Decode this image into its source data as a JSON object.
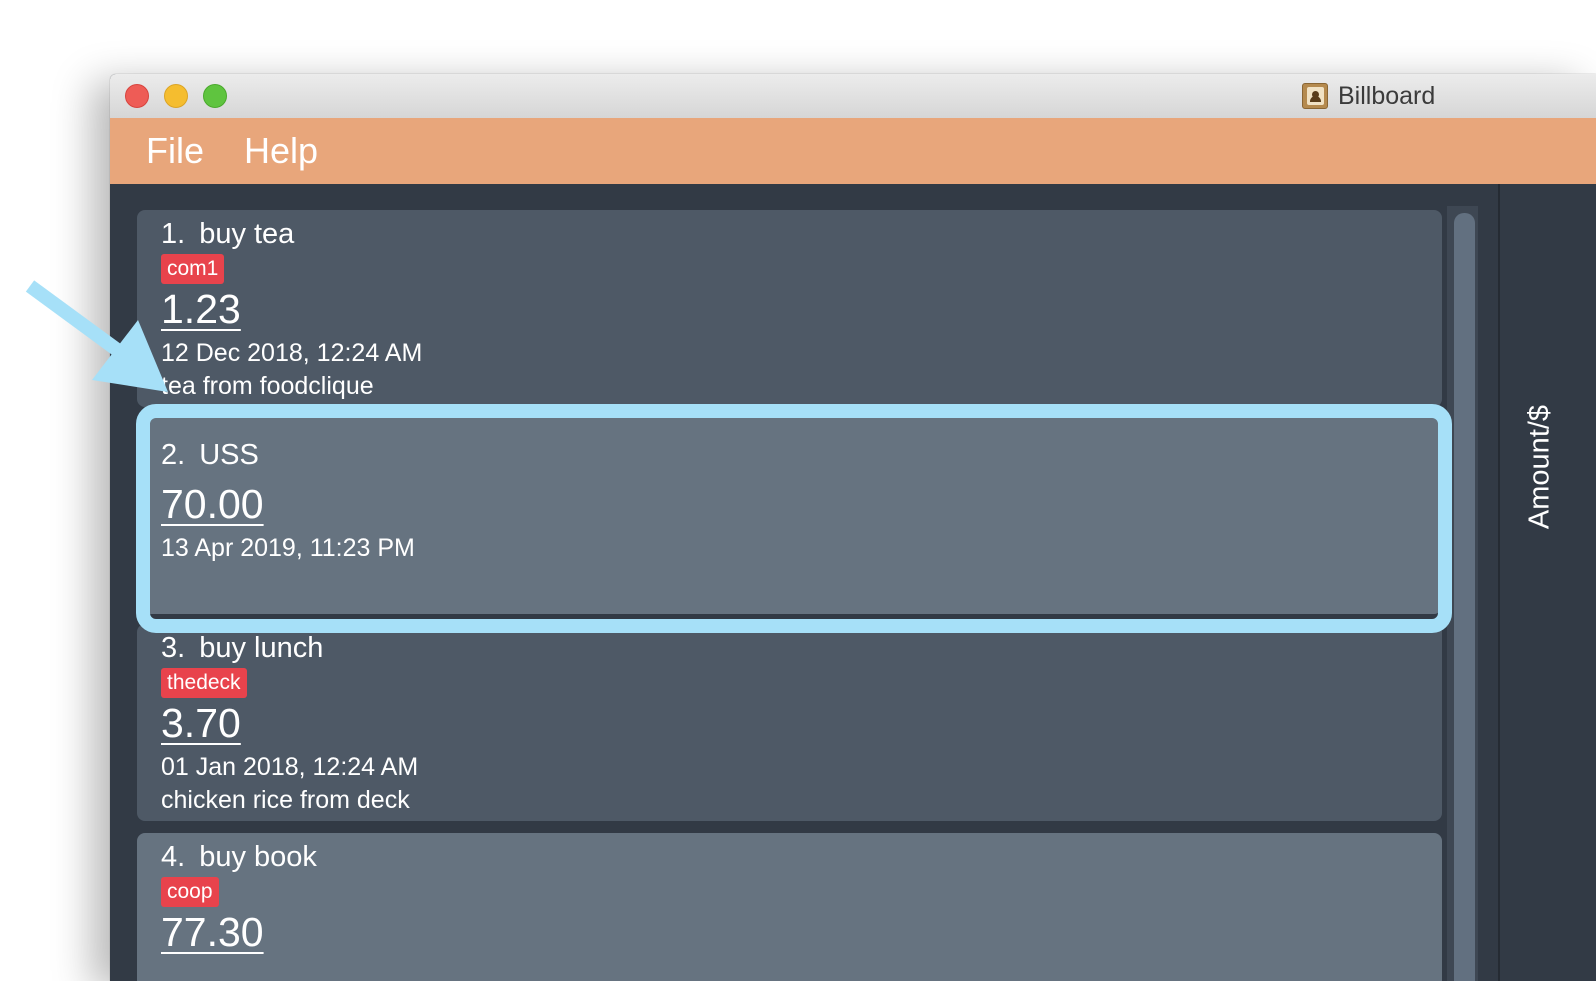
{
  "window": {
    "title": "Billboard",
    "icon": "contacts-book-icon"
  },
  "menu": [
    {
      "label": "File"
    },
    {
      "label": "Help"
    }
  ],
  "expenses": [
    {
      "index": "1.",
      "name": "buy tea",
      "tag": "com1",
      "amount": "1.23",
      "date": "12 Dec 2018, 12:24 AM",
      "description": "tea from foodclique"
    },
    {
      "index": "2.",
      "name": "USS",
      "tag": "",
      "amount": "70.00",
      "date": "13 Apr 2019, 11:23 PM",
      "description": ""
    },
    {
      "index": "3.",
      "name": "buy lunch",
      "tag": "thedeck",
      "amount": "3.70",
      "date": "01 Jan 2018, 12:24 AM",
      "description": "chicken rice from deck"
    },
    {
      "index": "4.",
      "name": "buy book",
      "tag": "coop",
      "amount": "77.30",
      "date": "",
      "description": ""
    }
  ],
  "side_panel": {
    "axis_label": "Amount/$"
  },
  "annotation": {
    "highlight_color": "#a6e0f8",
    "highlighted_item_index": 2
  },
  "colors": {
    "menubar": "#e8a67b",
    "card": "#4e5966",
    "card_selected": "#667380",
    "tag": "#e8434c",
    "background": "#323a45"
  }
}
